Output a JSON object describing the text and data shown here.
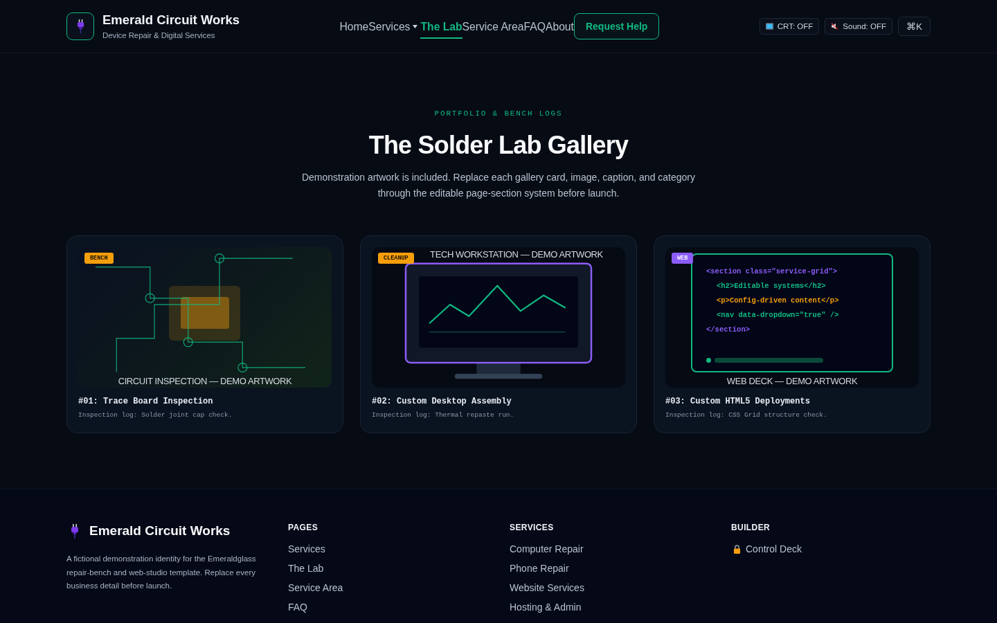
{
  "header": {
    "brand": {
      "title": "Emerald Circuit Works",
      "subtitle": "Device Repair & Digital Services"
    },
    "nav": [
      {
        "label": "Home",
        "selected": false,
        "dropdown": false
      },
      {
        "label": "Services",
        "selected": false,
        "dropdown": true
      },
      {
        "label": "The Lab",
        "selected": true,
        "dropdown": false
      },
      {
        "label": "Service Area",
        "selected": false,
        "dropdown": false
      },
      {
        "label": "FAQ",
        "selected": false,
        "dropdown": false
      },
      {
        "label": "About",
        "selected": false,
        "dropdown": false
      }
    ],
    "cta": {
      "label": "Request Help"
    },
    "toggles": [
      {
        "kind": "crt",
        "label": "CRT: OFF"
      },
      {
        "kind": "sound",
        "label": "Sound: OFF"
      },
      {
        "kind": "command",
        "label": "⌘K"
      }
    ]
  },
  "hero": {
    "eyebrow": "PORTFOLIO & BENCH LOGS",
    "title": "The Solder Lab Gallery",
    "description": "Demonstration artwork is included. Replace each gallery card, image, caption, and category through the editable page-section system before launch."
  },
  "cards": [
    {
      "tag": {
        "label": "BENCH",
        "color": "#f59e0b"
      },
      "art": {
        "kind": "circuit",
        "caption": "CIRCUIT INSPECTION — DEMO ARTWORK"
      },
      "title": "#01: Trace Board Inspection",
      "log": "Inspection log: Solder joint cap check."
    },
    {
      "tag": {
        "label": "CLEANUP",
        "color": "#f59e0b"
      },
      "art": {
        "kind": "workstation",
        "caption": "TECH WORKSTATION — DEMO ARTWORK"
      },
      "title": "#02: Custom Desktop Assembly",
      "log": "Inspection log: Thermal repaste run."
    },
    {
      "tag": {
        "label": "WEB",
        "color": "#8b5cf6"
      },
      "art": {
        "kind": "code",
        "caption": "WEB DECK — DEMO ARTWORK",
        "code_lines": [
          {
            "text": "<section class=\"service-grid\">",
            "color": "#8b5cf6",
            "children": [
              {
                "text": "<h2>Editable systems</h2>",
                "color": "#10b981"
              },
              {
                "text": "<p>Config-driven content</p>",
                "color": "#f59e0b"
              },
              {
                "text": "<nav data-dropdown=\"true\" />",
                "color": "#10b981"
              }
            ]
          },
          {
            "text": "</section>",
            "color": "#8b5cf6"
          }
        ]
      },
      "title": "#03: Custom HTML5 Deployments",
      "log": "Inspection log: CSS Grid structure check."
    }
  ],
  "footer": {
    "brand": {
      "name": "Emerald Circuit Works",
      "description": "A fictional demonstration identity for the Emeraldglass repair-bench and web-studio template. Replace every business detail before launch."
    },
    "columns": [
      {
        "heading": "PAGES",
        "links": [
          {
            "label": "Services",
            "locked": false
          },
          {
            "label": "The Lab",
            "locked": false
          },
          {
            "label": "Service Area",
            "locked": false
          },
          {
            "label": "FAQ",
            "locked": false
          }
        ]
      },
      {
        "heading": "SERVICES",
        "links": [
          {
            "label": "Computer Repair",
            "locked": false
          },
          {
            "label": "Phone Repair",
            "locked": false
          },
          {
            "label": "Website Services",
            "locked": false
          },
          {
            "label": "Hosting & Admin",
            "locked": false
          }
        ]
      },
      {
        "heading": "BUILDER",
        "links": [
          {
            "label": "Control Deck",
            "locked": true
          }
        ]
      }
    ]
  }
}
